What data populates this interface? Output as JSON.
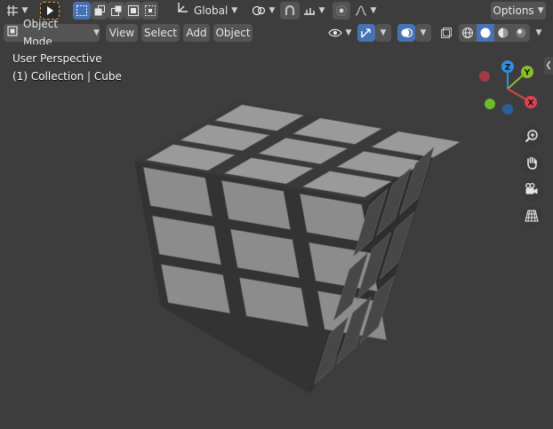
{
  "header_row1": {
    "transform_orientation": "Global",
    "options_label": "Options"
  },
  "header_row2": {
    "mode_label": "Object Mode",
    "menus": [
      "View",
      "Select",
      "Add",
      "Object"
    ]
  },
  "viewport": {
    "view_label": "User Perspective",
    "collection_label": "(1) Collection | Cube"
  },
  "gizmo": {
    "axes": [
      "X",
      "Y",
      "Z"
    ],
    "colors": {
      "x": "#e0404f",
      "y": "#8bbd2b",
      "z": "#2f8fe8",
      "x_neg": "#a03c45",
      "y_neg": "#6dbb2a",
      "z_neg": "#2a5f9e"
    }
  },
  "colors": {
    "accent": "#4772b3",
    "header_bg": "#3d3d3d",
    "button_bg": "#545454",
    "cube_top": "#9a9a9a",
    "cube_left": "#8c8c8c",
    "cube_right": "#474747"
  },
  "icons": {
    "editor_type": "grid-icon",
    "select_tool": "cursor-icon",
    "pivot": "pivot-icon",
    "snap": "magnet-icon",
    "proportional": "proportional-icon",
    "visibility": "eye-icon",
    "gizmo_toggle": "gizmo-icon",
    "overlay": "overlay-icon",
    "xray": "xray-icon",
    "shading": [
      "wireframe-icon",
      "solid-icon",
      "material-icon",
      "rendered-icon"
    ],
    "navigation": [
      "zoom-icon",
      "hand-icon",
      "camera-icon",
      "grid-view-icon"
    ]
  }
}
